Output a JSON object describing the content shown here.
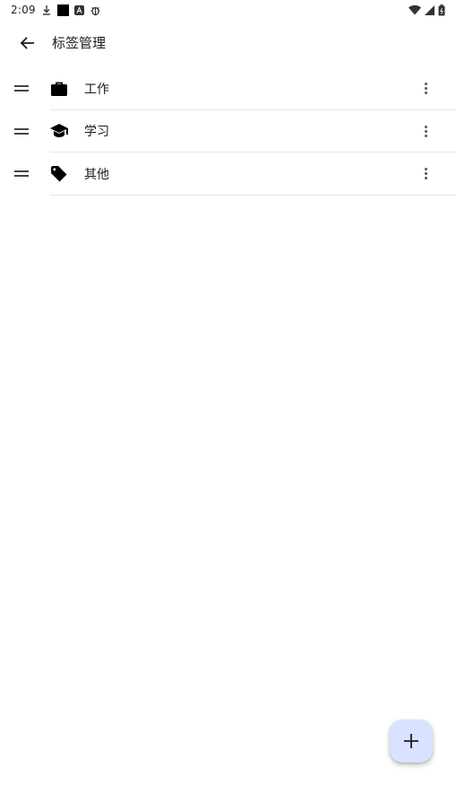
{
  "status_bar": {
    "time": "2:09",
    "icons_left": [
      "download-icon",
      "square-icon",
      "a-badge-icon",
      "bug-icon"
    ],
    "icons_right": [
      "wifi-icon",
      "signal-icon",
      "battery-icon"
    ]
  },
  "app_bar": {
    "title": "标签管理",
    "back_icon": "arrow-back-icon"
  },
  "tags": [
    {
      "label": "工作",
      "icon": "briefcase-icon"
    },
    {
      "label": "学习",
      "icon": "school-icon"
    },
    {
      "label": "其他",
      "icon": "tag-icon"
    }
  ],
  "fab": {
    "icon": "add-icon"
  },
  "colors": {
    "fab_background": "#d9e2ff",
    "divider": "#e6e6e6",
    "text": "#1c1b1f"
  }
}
